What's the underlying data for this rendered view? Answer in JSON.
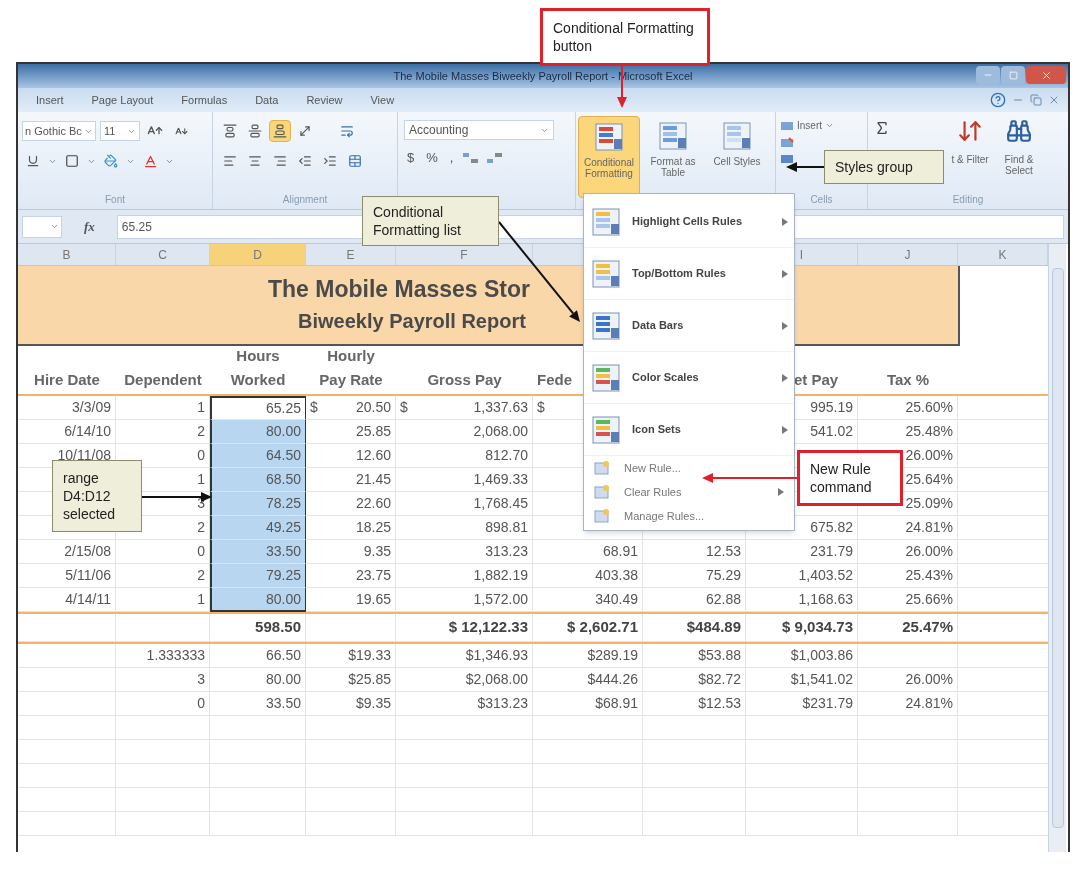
{
  "window": {
    "title": "The Mobile Masses Biweekly Payroll Report - Microsoft Excel"
  },
  "ribbon_tabs": [
    "Insert",
    "Page Layout",
    "Formulas",
    "Data",
    "Review",
    "View"
  ],
  "ribbon": {
    "font_name": "n Gothic Bc",
    "font_size": "11",
    "vertical_align": [
      {
        "selected": false
      },
      {
        "selected": false
      },
      {
        "selected": true
      }
    ],
    "number_format": "Accounting",
    "number_buttons": [
      "$",
      "%",
      ","
    ],
    "styles_buttons": [
      {
        "label": "Conditional Formatting",
        "selected": true
      },
      {
        "label": "Format as Table",
        "selected": false
      },
      {
        "label": "Cell Styles",
        "selected": false
      }
    ],
    "cells_insert": "Insert",
    "editing_buttons": [
      "t & Filter",
      "Find & Select"
    ],
    "group_labels": {
      "font": "Font",
      "alignment": "Alignment",
      "cells": "Cells",
      "editing": "Editing"
    }
  },
  "formula_bar": {
    "function_label": "fx",
    "value": "65.25"
  },
  "column_headers": {
    "hire_date": {
      "label": "B",
      "selected": false
    },
    "dependents": {
      "label": "C",
      "selected": false
    },
    "hours": {
      "label": "D",
      "selected": true
    },
    "rate": {
      "label": "E",
      "selected": false
    },
    "gross": {
      "label": "F",
      "selected": false
    },
    "net_pay": {
      "label": "I",
      "selected": false
    },
    "tax_pct": {
      "label": "J",
      "selected": false
    },
    "column_k": {
      "label": "K",
      "selected": false
    }
  },
  "sheet": {
    "title_lines": [
      "The Mobile Masses Stor",
      "Biweekly Payroll Report"
    ],
    "headings": {
      "hire_date": [
        "Hire Date"
      ],
      "dependents": [
        "Dependent"
      ],
      "hours": [
        "Hours",
        "Worked"
      ],
      "rate": [
        "Hourly",
        "Pay Rate"
      ],
      "gross": [
        "Gross Pay"
      ],
      "federal_tax": [
        "Fede"
      ],
      "net_pay": [
        "et Pay"
      ],
      "tax_pct": [
        "Tax %"
      ]
    },
    "rows": [
      {
        "selected": true,
        "active": true,
        "cells": {
          "hire_date": "3/3/09",
          "dependents": "1",
          "hours": "65.25",
          "rate": {
            "sign": "$",
            "value": "20.50"
          },
          "gross": {
            "sign": "$",
            "value": "1,337.63"
          },
          "federal_tax": {
            "sign": "$"
          },
          "net_pay": "995.19",
          "tax_pct": "25.60%"
        }
      },
      {
        "selected": true,
        "active": false,
        "cells": {
          "hire_date": "6/14/10",
          "dependents": "2",
          "hours": "80.00",
          "rate": "25.85",
          "gross": "2,068.00",
          "net_pay": "541.02",
          "tax_pct": "25.48%"
        }
      },
      {
        "selected": true,
        "active": false,
        "cells": {
          "hire_date": "10/11/08",
          "dependents": "0",
          "hours": "64.50",
          "rate": "12.60",
          "gross": "812.70",
          "tax_pct": "26.00%"
        }
      },
      {
        "selected": true,
        "active": false,
        "cells": {
          "dependents": "1",
          "hours": "68.50",
          "rate": "21.45",
          "gross": "1,469.33",
          "tax_pct": "25.64%"
        }
      },
      {
        "selected": true,
        "active": false,
        "cells": {
          "dependents": "3",
          "hours": "78.25",
          "rate": "22.60",
          "gross": "1,768.45",
          "tax_pct": "25.09%"
        }
      },
      {
        "selected": true,
        "active": false,
        "cells": {
          "dependents": "2",
          "hours": "49.25",
          "rate": "18.25",
          "gross": "898.81",
          "net_pay": "675.82",
          "tax_pct": "24.81%"
        }
      },
      {
        "selected": true,
        "active": false,
        "cells": {
          "hire_date": "2/15/08",
          "dependents": "0",
          "hours": "33.50",
          "rate": "9.35",
          "gross": "313.23",
          "federal_tax": "68.91",
          "state_tax": "12.53",
          "net_pay": "231.79",
          "tax_pct": "26.00%"
        }
      },
      {
        "selected": true,
        "active": false,
        "cells": {
          "hire_date": "5/11/06",
          "dependents": "2",
          "hours": "79.25",
          "rate": "23.75",
          "gross": "1,882.19",
          "federal_tax": "403.38",
          "state_tax": "75.29",
          "net_pay": "1,403.52",
          "tax_pct": "25.43%"
        }
      },
      {
        "selected": true,
        "active": false,
        "cells": {
          "hire_date": "4/14/11",
          "dependents": "1",
          "hours": "80.00",
          "rate": "19.65",
          "gross": "1,572.00",
          "federal_tax": "340.49",
          "state_tax": "62.88",
          "net_pay": "1,168.63",
          "tax_pct": "25.66%"
        }
      }
    ],
    "totals": {
      "hours": "598.50",
      "gross": "$ 12,122.33",
      "federal_tax": "$ 2,602.71",
      "state_tax": "$484.89",
      "net_pay": "$ 9,034.73",
      "tax_pct": "25.47%"
    },
    "stats_rows": [
      {
        "dependents": "1.333333",
        "hours": "66.50",
        "rate": "$19.33",
        "gross": "$1,346.93",
        "federal_tax": "$289.19",
        "state_tax": "$53.88",
        "net_pay": "$1,003.86"
      },
      {
        "dependents": "3",
        "hours": "80.00",
        "rate": "$25.85",
        "gross": "$2,068.00",
        "federal_tax": "$444.26",
        "state_tax": "$82.72",
        "net_pay": "$1,541.02",
        "tax_pct": "26.00%"
      },
      {
        "dependents": "0",
        "hours": "33.50",
        "rate": "$9.35",
        "gross": "$313.23",
        "federal_tax": "$68.91",
        "state_tax": "$12.53",
        "net_pay": "$231.79",
        "tax_pct": "24.81%"
      }
    ]
  },
  "menu": {
    "items": [
      {
        "kind": "large",
        "label": "Highlight Cells Rules",
        "submenu": true
      },
      {
        "kind": "large",
        "label": "Top/Bottom Rules",
        "submenu": true
      },
      {
        "kind": "large",
        "label": "Data Bars",
        "submenu": true
      },
      {
        "kind": "large",
        "label": "Color Scales",
        "submenu": true
      },
      {
        "kind": "large",
        "label": "Icon Sets",
        "submenu": true
      },
      {
        "kind": "small",
        "label": "New Rule...",
        "submenu": false
      },
      {
        "kind": "small",
        "label": "Clear Rules",
        "submenu": true
      },
      {
        "kind": "small",
        "label": "Manage Rules...",
        "submenu": false
      }
    ]
  },
  "callouts": [
    {
      "kind": "red",
      "text": "Conditional Formatting button"
    },
    {
      "kind": "beige",
      "text": "Styles group"
    },
    {
      "kind": "beige",
      "text": "Conditional Formatting list"
    },
    {
      "kind": "beige",
      "text": "range D4:D12 selected"
    },
    {
      "kind": "red",
      "text": "New Rule command"
    }
  ]
}
